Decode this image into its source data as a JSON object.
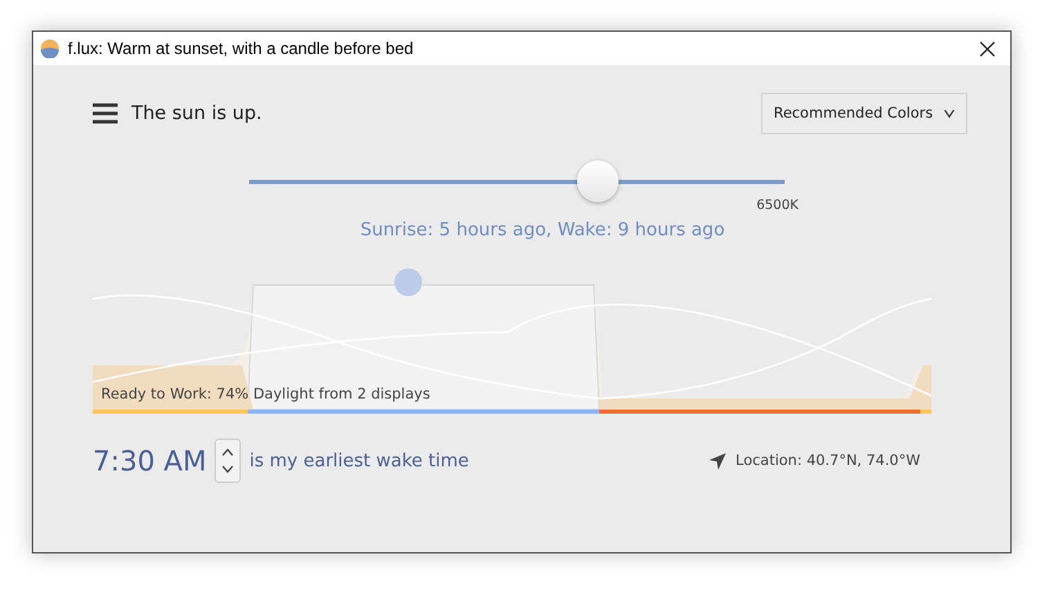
{
  "window": {
    "title": "f.lux: Warm at sunset, with a candle before bed"
  },
  "status": "The sun is up.",
  "color_preset": {
    "label": "Recommended Colors"
  },
  "color_slider": {
    "level": 0.65,
    "reading": "6500K"
  },
  "sun_info": "Sunrise: 5 hours ago, Wake: 9 hours ago",
  "chart_caption": "Ready to Work: 74% Daylight from 2 displays",
  "wake": {
    "time": "7:30 AM",
    "label": "is my earliest wake time"
  },
  "location": "Location: 40.7°N, 74.0°W"
}
